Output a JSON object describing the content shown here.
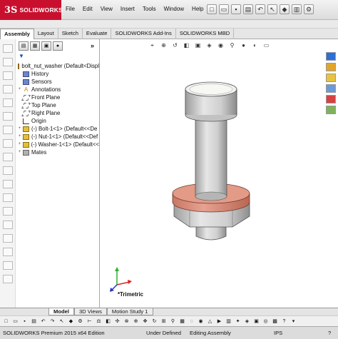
{
  "app": {
    "logo_ds": "3S",
    "logo_name": "SOLIDWORKS"
  },
  "menu": [
    "File",
    "Edit",
    "View",
    "Insert",
    "Tools",
    "Window",
    "Help"
  ],
  "command_tabs": [
    {
      "label": "Assembly",
      "active": true
    },
    {
      "label": "Layout",
      "active": false
    },
    {
      "label": "Sketch",
      "active": false
    },
    {
      "label": "Evaluate",
      "active": false
    },
    {
      "label": "SOLIDWORKS Add-Ins",
      "active": false
    },
    {
      "label": "SOLIDWORKS MBD",
      "active": false
    }
  ],
  "feature_tree": {
    "root": "bolt_nut_washer  (Default<Displ",
    "items": [
      {
        "label": "History",
        "icon": "folder-icon"
      },
      {
        "label": "Sensors",
        "icon": "sensor-icon"
      },
      {
        "label": "Annotations",
        "icon": "annotation-icon"
      },
      {
        "label": "Front Plane",
        "icon": "plane-icon"
      },
      {
        "label": "Top Plane",
        "icon": "plane-icon"
      },
      {
        "label": "Right Plane",
        "icon": "plane-icon"
      },
      {
        "label": "Origin",
        "icon": "origin-icon"
      },
      {
        "label": "(-) Bolt-1<1> (Default<<De",
        "icon": "part-icon"
      },
      {
        "label": "(-) Nut-1<1> (Default<<Def",
        "icon": "part-icon"
      },
      {
        "label": "(-) Washer-1<1> (Default<<",
        "icon": "part-icon"
      },
      {
        "label": "Mates",
        "icon": "mates-icon"
      }
    ]
  },
  "viewport": {
    "view_name": "*Trimetric",
    "colors": {
      "washer": "#d98a78",
      "metal": "#d8d8d8",
      "metal_dark": "#a9a9a9"
    }
  },
  "bottom_tabs": [
    {
      "label": "Model",
      "active": true
    },
    {
      "label": "3D Views",
      "active": false
    },
    {
      "label": "Motion Study 1",
      "active": false
    }
  ],
  "status": {
    "product": "SOLIDWORKS Premium 2015 x64 Edition",
    "definition": "Under Defined",
    "mode": "Editing Assembly",
    "units": "IPS"
  }
}
